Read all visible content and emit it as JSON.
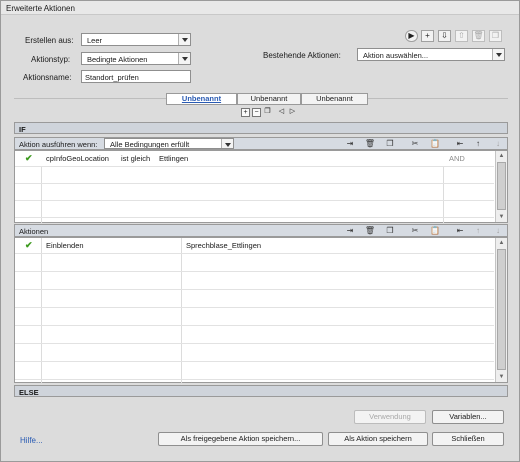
{
  "window": {
    "title": "Erweiterte Aktionen"
  },
  "form": {
    "create_from_label": "Erstellen aus:",
    "create_from_value": "Leer",
    "action_type_label": "Aktionstyp:",
    "action_type_value": "Bedingte Aktionen",
    "action_name_label": "Aktionsname:",
    "action_name_value": "Standort_prüfen",
    "existing_label": "Bestehende Aktionen:",
    "existing_value": "Aktion auswählen..."
  },
  "tabs": [
    "Unbenannt",
    "Unbenannt",
    "Unbenannt"
  ],
  "if_section": {
    "header": "IF",
    "condition_label": "Aktion ausführen wenn:",
    "condition_value": "Alle Bedingungen erfüllt",
    "row": {
      "variable": "cpInfoGeoLocation",
      "operator": "ist gleich",
      "value": "Ettlingen",
      "logic": "AND"
    }
  },
  "actions_section": {
    "header": "Aktionen",
    "row": {
      "command": "Einblenden",
      "target": "Sprechblase_Ettlingen"
    }
  },
  "else_section": {
    "header": "ELSE"
  },
  "buttons": {
    "usage": "Verwendung",
    "variables": "Variablen...",
    "save_shared": "Als freigegebene Aktion speichern...",
    "save_action": "Als Aktion speichern",
    "close": "Schließen"
  },
  "help": "Hilfe...",
  "colors": {
    "accent": "#2a5bb3",
    "check": "#3c9a1e"
  }
}
